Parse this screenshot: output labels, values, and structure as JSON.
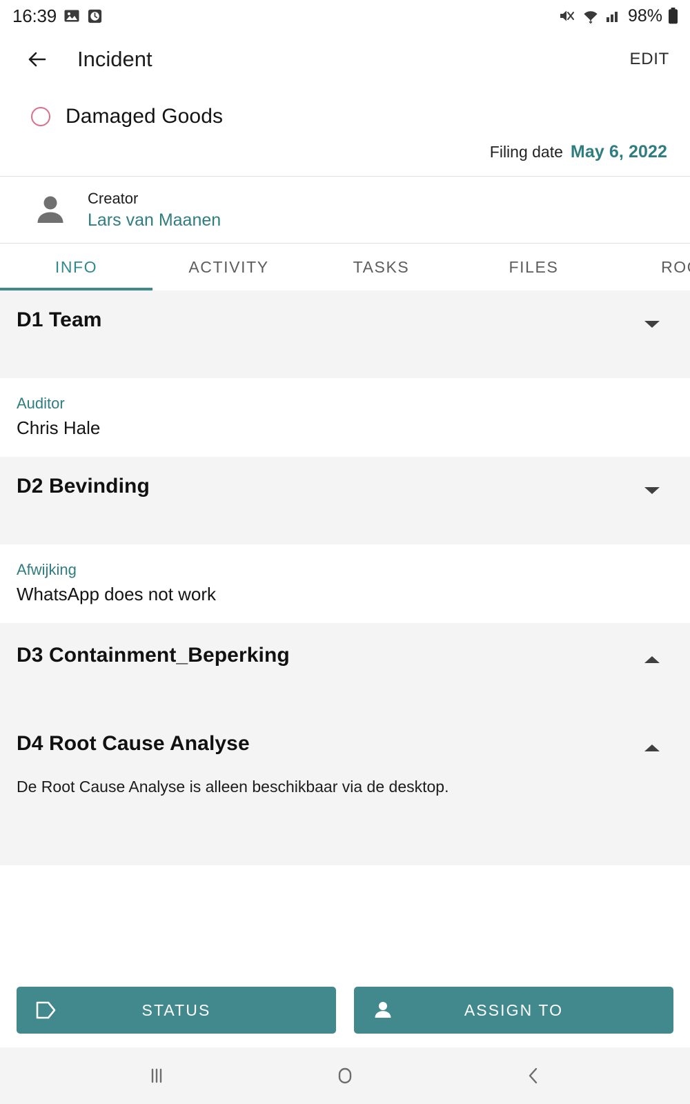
{
  "status_bar": {
    "time": "16:39",
    "battery_percent": "98%",
    "icons": [
      "image-icon",
      "alarm-icon",
      "mute-icon",
      "wifi-icon",
      "signal-icon",
      "battery-icon"
    ]
  },
  "app_bar": {
    "back_icon": "back-arrow-icon",
    "title": "Incident",
    "edit_label": "EDIT"
  },
  "record": {
    "status_indicator": "open-circle-icon",
    "title": "Damaged Goods",
    "filing_date_label": "Filing date",
    "filing_date_value": "May 6, 2022"
  },
  "creator": {
    "avatar_icon": "person-icon",
    "label": "Creator",
    "name": "Lars van Maanen"
  },
  "tabs": [
    {
      "label": "INFO",
      "active": true
    },
    {
      "label": "ACTIVITY",
      "active": false
    },
    {
      "label": "TASKS",
      "active": false
    },
    {
      "label": "FILES",
      "active": false
    },
    {
      "label": "ROOT",
      "active": false
    }
  ],
  "sections": [
    {
      "title": "D1 Team",
      "chevron": "chevron-down-icon",
      "field_label": "Auditor",
      "field_value": "Chris Hale"
    },
    {
      "title": "D2 Bevinding",
      "chevron": "chevron-down-icon",
      "field_label": "Afwijking",
      "field_value": "WhatsApp does not work"
    },
    {
      "title": "D3 Containment_Beperking",
      "chevron": "chevron-up-icon"
    },
    {
      "title": "D4 Root Cause Analyse",
      "chevron": "chevron-up-icon",
      "note": "De Root Cause Analyse is alleen beschikbaar via de desktop."
    }
  ],
  "actions": {
    "status_button": {
      "label": "STATUS",
      "icon": "tag-icon"
    },
    "assign_button": {
      "label": "ASSIGN TO",
      "icon": "person-icon"
    }
  },
  "nav_bar": {
    "recents_icon": "recents-icon",
    "home_icon": "home-icon",
    "back_icon": "nav-back-icon"
  },
  "colors": {
    "accent_teal": "#42898d",
    "link_teal": "#2f7d80",
    "status_pink": "#dc6f88",
    "section_grey": "#f4f4f4"
  }
}
